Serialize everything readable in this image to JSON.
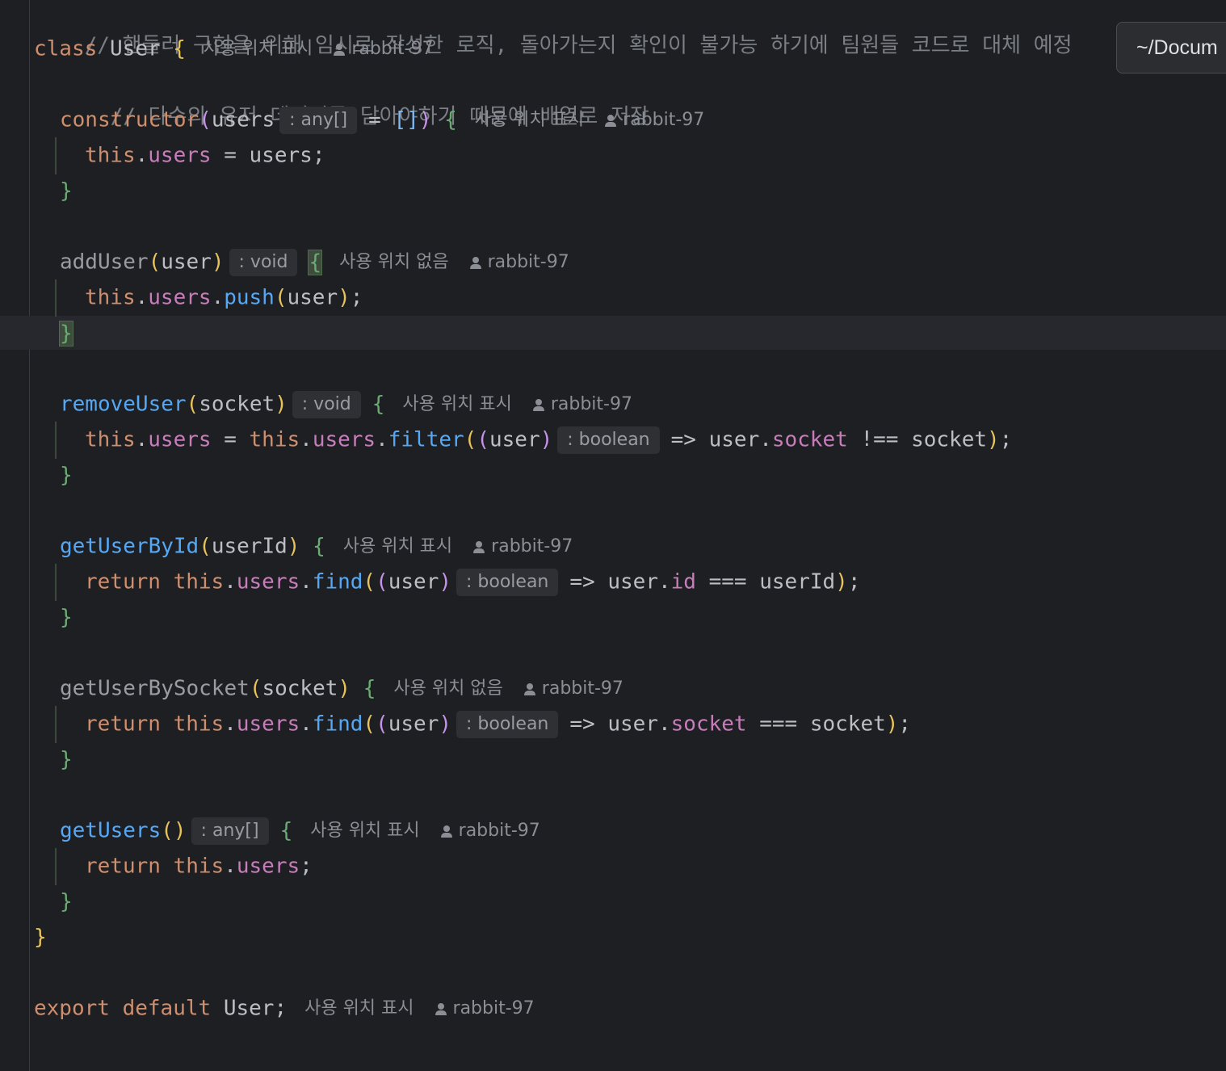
{
  "tooltip": {
    "path": "~/Docum"
  },
  "code": {
    "comment_top": "// 핸들러 구현을 위해 임시로 작성한 로직, 돌아가는지 확인이 불가능 하기에 팀원들 코드로 대체 예정",
    "class_kw": "class",
    "class_name": "User",
    "comment_inner": "// 다수의 유저 데이터를 담아야하기 때문에 배열로 저장",
    "constructor": "constructor",
    "users": "users",
    "user": "user",
    "socket": "socket",
    "userId": "userId",
    "this": "this",
    "return": "return",
    "push": "push",
    "filter": "filter",
    "find": "find",
    "id": "id",
    "addUser": "addUser",
    "removeUser": "removeUser",
    "getUserById": "getUserById",
    "getUserBySocket": "getUserBySocket",
    "getUsers": "getUsers",
    "export": "export",
    "default": "default"
  },
  "hints": {
    "any_array": ": any[]",
    "void": ": void",
    "boolean": ": boolean"
  },
  "lens": {
    "show_usages": "사용 위치 표시",
    "no_usages": "사용 위치 없음",
    "author": "rabbit-97"
  },
  "icons": {
    "author": "person-icon"
  }
}
